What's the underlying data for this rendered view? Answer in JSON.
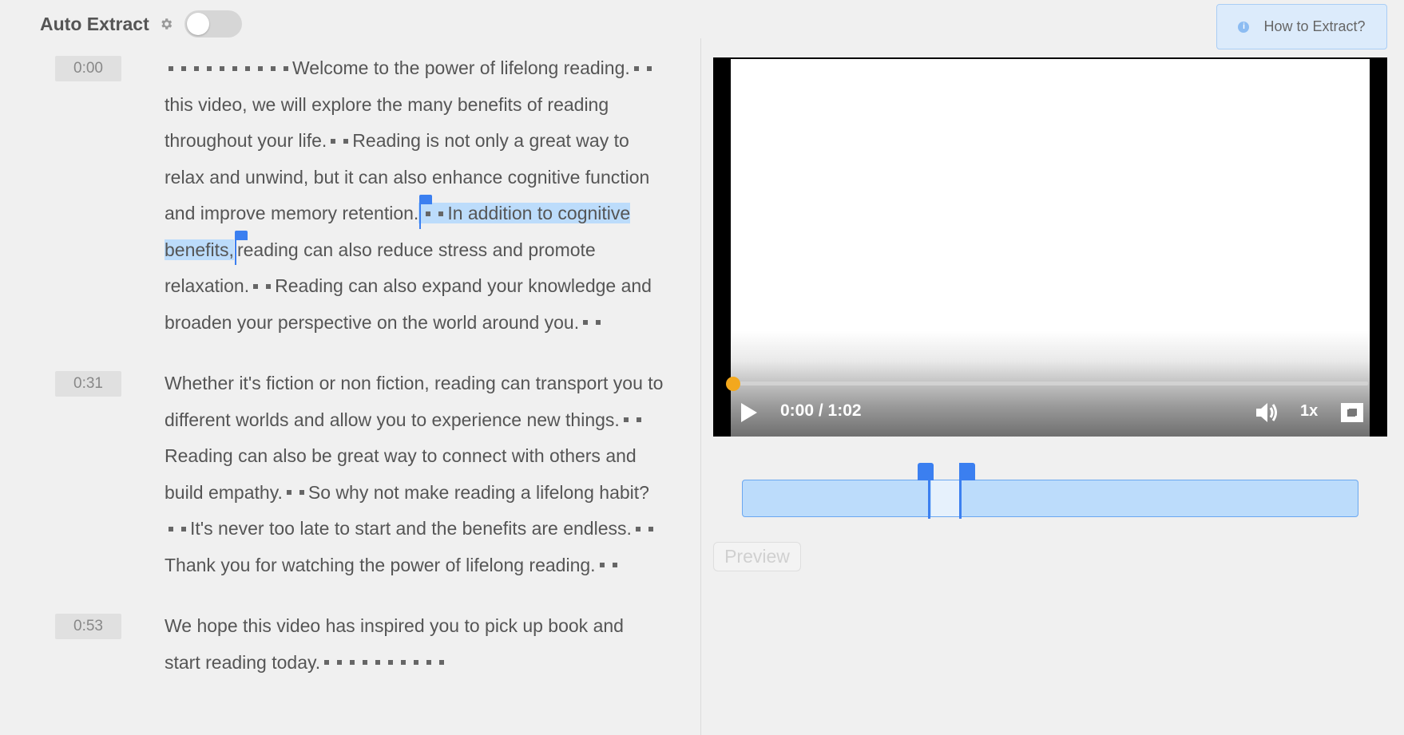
{
  "header": {
    "title": "Auto Extract",
    "toggle_on": false
  },
  "help": {
    "label": "How to Extract?"
  },
  "transcript": [
    {
      "timestamp": "0:00",
      "lines": [
        [
          "Welcome to the power of lifelong reading."
        ],
        [
          "this video, we will explore the many benefits of reading"
        ],
        [
          "throughout your life.",
          "Reading is not only a great way to"
        ],
        [
          "relax and unwind, but it can also enhance cognitive function"
        ],
        [
          "and improve memory retention.",
          "In addition to cognitive"
        ],
        [
          "benefits,",
          "reading can also reduce stress and promote"
        ],
        [
          "relaxation.",
          "Reading can also expand your knowledge and"
        ],
        [
          "broaden your perspective on the world around you."
        ]
      ]
    },
    {
      "timestamp": "0:31",
      "lines": [
        [
          "Whether it's fiction or non fiction, reading can transport you to"
        ],
        [
          "different worlds and allow you to experience new things."
        ],
        [
          "Reading can also be great way to connect with others and"
        ],
        [
          "build empathy.",
          "So why not make reading a lifelong habit?"
        ],
        [
          "It's never too late to start and the benefits are endless."
        ],
        [
          "Thank you for watching the power of lifelong reading."
        ]
      ]
    },
    {
      "timestamp": "0:53",
      "lines": [
        [
          "We hope this video has inspired you to pick up book and"
        ],
        [
          "start reading today."
        ]
      ]
    }
  ],
  "player": {
    "time": "0:00 / 1:02",
    "speed": "1x",
    "progress": 0.0
  },
  "segment": {
    "start_fraction": 0.31,
    "end_fraction": 0.355
  },
  "preview": {
    "label": "Preview"
  },
  "colors": {
    "accent": "#3b7ff0",
    "highlight": "#bcdcfb",
    "thumb": "#f3a81d"
  }
}
